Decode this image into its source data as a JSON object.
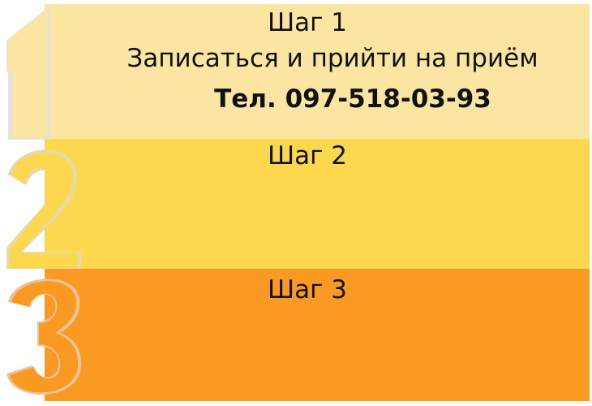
{
  "steps": [
    {
      "title": "Шаг 1",
      "description": "Записаться и прийти на приём",
      "phone": "Тел. 097-518-03-93",
      "color": "#fbe5a3"
    },
    {
      "title": "Шаг 2",
      "color": "#fcd84f"
    },
    {
      "title": "Шаг 3",
      "color": "#fa9a23"
    }
  ],
  "digit_icons": [
    "digit-one-icon",
    "digit-two-icon",
    "digit-three-icon"
  ]
}
